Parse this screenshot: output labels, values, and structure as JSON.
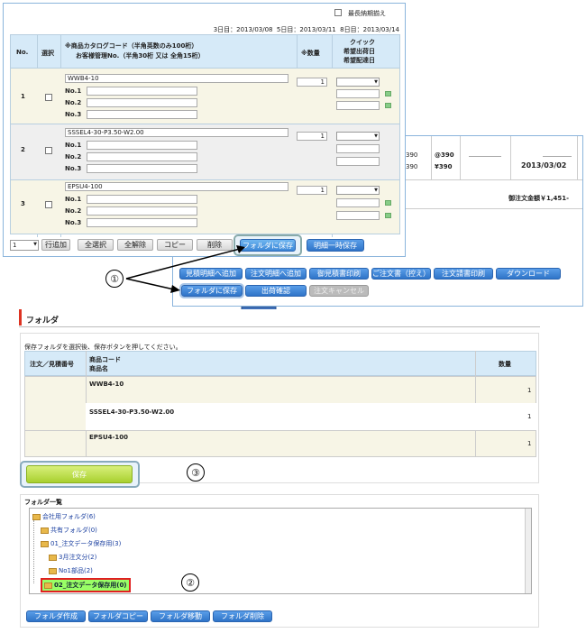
{
  "form": {
    "urgent_label": "最長納期揃え",
    "dates": "3日目：2013/03/08  5日目：2013/03/11  8日目：2013/03/14",
    "hdr_no": "No.",
    "hdr_select": "選択",
    "hdr_code1": "※商品カタログコード（半角英数のみ100桁）",
    "hdr_code2": "お客様管理No.（半角30桁 又は 全角15桁）",
    "hdr_qty": "※数量",
    "hdr_quick1": "クイック",
    "hdr_quick2": "希望出荷日",
    "hdr_quick3": "希望配達日",
    "rows": [
      {
        "no": "1",
        "code": "WWB4-10",
        "qty": "1"
      },
      {
        "no": "2",
        "code": "SSSEL4-30-P3.50-W2.00",
        "qty": "1"
      },
      {
        "no": "3",
        "code": "EPSU4-100",
        "qty": "1"
      }
    ],
    "sub_labels": [
      "No.1",
      "No.2",
      "No.3"
    ],
    "count_value": "1",
    "add_rows": "行追加",
    "select_all": "全選択",
    "deselect_all": "全解除",
    "copy": "コピー",
    "delete": "削除",
    "save_folder": "フォルダに保存",
    "temp_save": "明細一時保存"
  },
  "back": {
    "at1": "@390",
    "at2": "390",
    "yen1": "390",
    "yen2": "¥390",
    "date": "2013/03/02",
    "total": "御注文金額￥1,451-",
    "btn_quote_add": "見積明細へ追加",
    "btn_order_add": "注文明細へ追加",
    "btn_quote_print": "御見積書印刷",
    "btn_order_copy": "ご注文書（控え）",
    "btn_order_print": "注文請書印刷",
    "btn_download": "ダウンロード",
    "btn_save_folder": "フォルダに保存",
    "btn_ship": "出荷確認",
    "btn_cancel": "注文キャンセル"
  },
  "annot": {
    "c1": "①",
    "c2": "②",
    "c3": "③"
  },
  "folder": {
    "title": "フォルダ",
    "instruction": "保存フォルダを選択後、保存ボタンを押してください。",
    "col_order": "注文／見積番号",
    "col_code1": "商品コード",
    "col_code2": "商品名",
    "col_qty": "数量",
    "items": [
      {
        "code": "WWB4-10",
        "qty": "1"
      },
      {
        "code": "SSSEL4-30-P3.50-W2.00",
        "qty": "1"
      },
      {
        "code": "EPSU4-100",
        "qty": "1"
      }
    ],
    "save": "保存",
    "list_title": "フォルダ一覧",
    "tree": [
      "会社用フォルダ(6)",
      "共有フォルダ(0)",
      "01_注文データ保存用(3)",
      "3月注文分(2)",
      "No1部品(2)",
      "02_注文データ保存用(0)"
    ],
    "btn_create": "フォルダ作成",
    "btn_copy": "フォルダコピー",
    "btn_move": "フォルダ移動",
    "btn_delete": "フォルダ削除"
  }
}
